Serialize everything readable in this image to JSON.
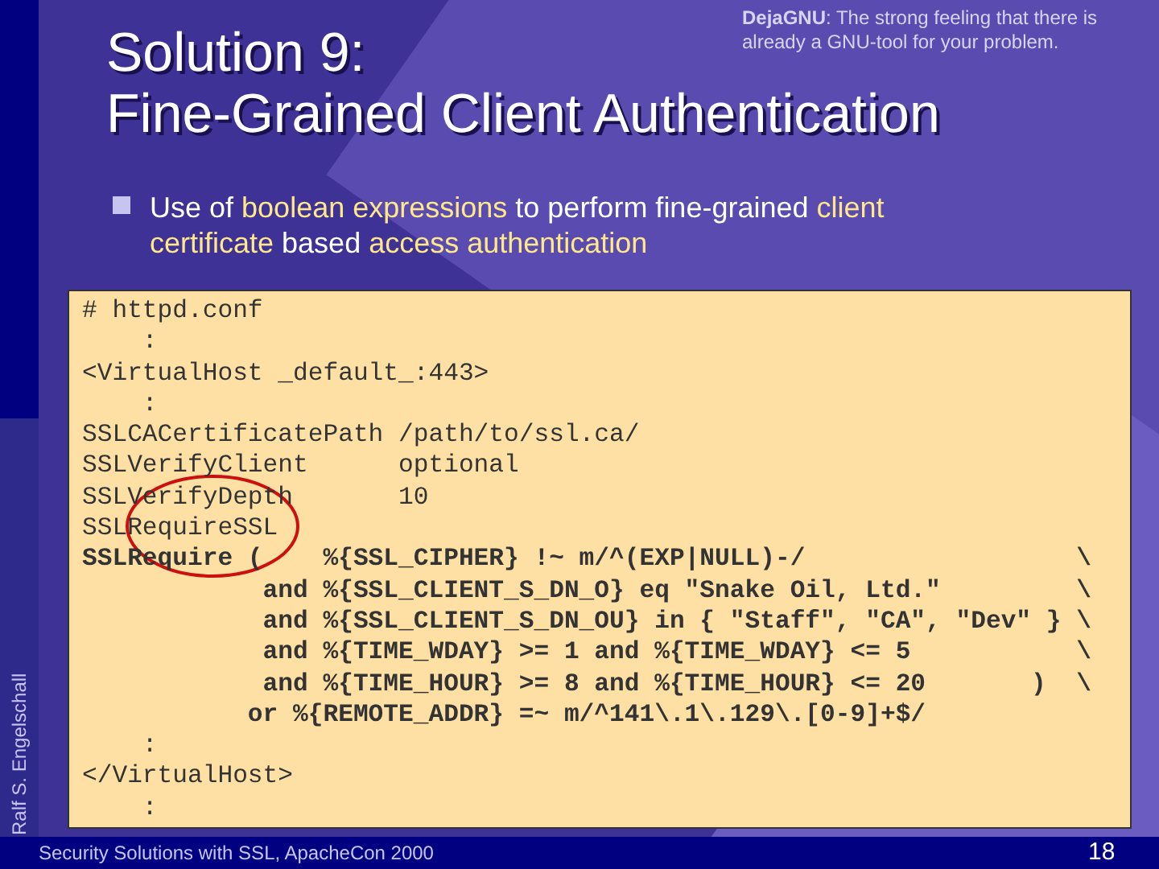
{
  "note": "**DejaGNU**: The strong feeling that there is already a GNU-tool for your problem.",
  "title": [
    "Solution 9:",
    "Fine-Grained Client Authentication"
  ],
  "bullet": [
    {
      "text": "Use of ",
      "highlight": false
    },
    {
      "text": "boolean expressions",
      "highlight": true
    },
    {
      "text": " to perform fine-grained ",
      "highlight": false
    },
    {
      "text": "client certificate",
      "highlight": true
    },
    {
      "text": " based ",
      "highlight": false
    },
    {
      "text": "access authentication",
      "highlight": true
    }
  ],
  "code": [
    {
      "text": "# httpd.conf",
      "bold": false
    },
    {
      "text": "    :",
      "bold": false
    },
    {
      "text": "<VirtualHost _default_:443>",
      "bold": false
    },
    {
      "text": "    :",
      "bold": false
    },
    {
      "text": "SSLCACertificatePath /path/to/ssl.ca/",
      "bold": false
    },
    {
      "text": "SSLVerifyClient      optional",
      "bold": false
    },
    {
      "text": "SSLVerifyDepth       10",
      "bold": false
    },
    {
      "text": "SSLRequireSSL",
      "bold": false
    },
    {
      "text": "SSLRequire (    %{SSL_CIPHER} !~ m/^(EXP|NULL)-/                  \\",
      "bold": true
    },
    {
      "text": "            and %{SSL_CLIENT_S_DN_O} eq \"Snake Oil, Ltd.\"         \\",
      "bold": true
    },
    {
      "text": "            and %{SSL_CLIENT_S_DN_OU} in { \"Staff\", \"CA\", \"Dev\" } \\",
      "bold": true
    },
    {
      "text": "            and %{TIME_WDAY} >= 1 and %{TIME_WDAY} <= 5           \\",
      "bold": true
    },
    {
      "text": "            and %{TIME_HOUR} >= 8 and %{TIME_HOUR} <= 20       )  \\",
      "bold": true
    },
    {
      "text": "           or %{REMOTE_ADDR} =~ m/^141\\.1\\.129\\.[0-9]+$/",
      "bold": true
    },
    {
      "text": "    :",
      "bold": false
    },
    {
      "text": "</VirtualHost>",
      "bold": false
    },
    {
      "text": "    :",
      "bold": false
    }
  ],
  "side_label": "Ralf S. Engelschall",
  "footer": "Security Solutions with SSL, ApacheCon 2000",
  "page_number": "18"
}
